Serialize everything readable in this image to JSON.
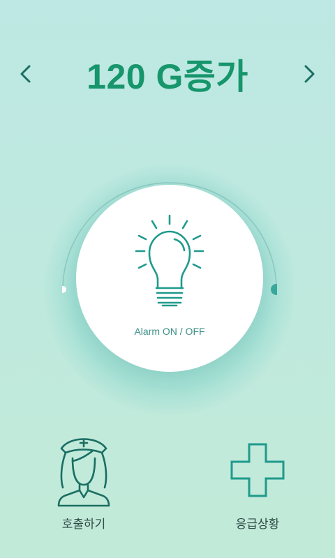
{
  "header": {
    "title": "120 G증가",
    "prev_icon": "chevron-left-icon",
    "next_icon": "chevron-right-icon"
  },
  "alarm": {
    "label": "Alarm ON / OFF",
    "icon": "lightbulb-icon"
  },
  "actions": [
    {
      "label": "호출하기",
      "icon": "nurse-icon"
    },
    {
      "label": "응급상황",
      "icon": "medical-cross-icon"
    }
  ],
  "colors": {
    "accent": "#17956b",
    "icon_stroke": "#1f9a8c",
    "dark_icon": "#1a6e62",
    "background": "#bde8e3"
  }
}
